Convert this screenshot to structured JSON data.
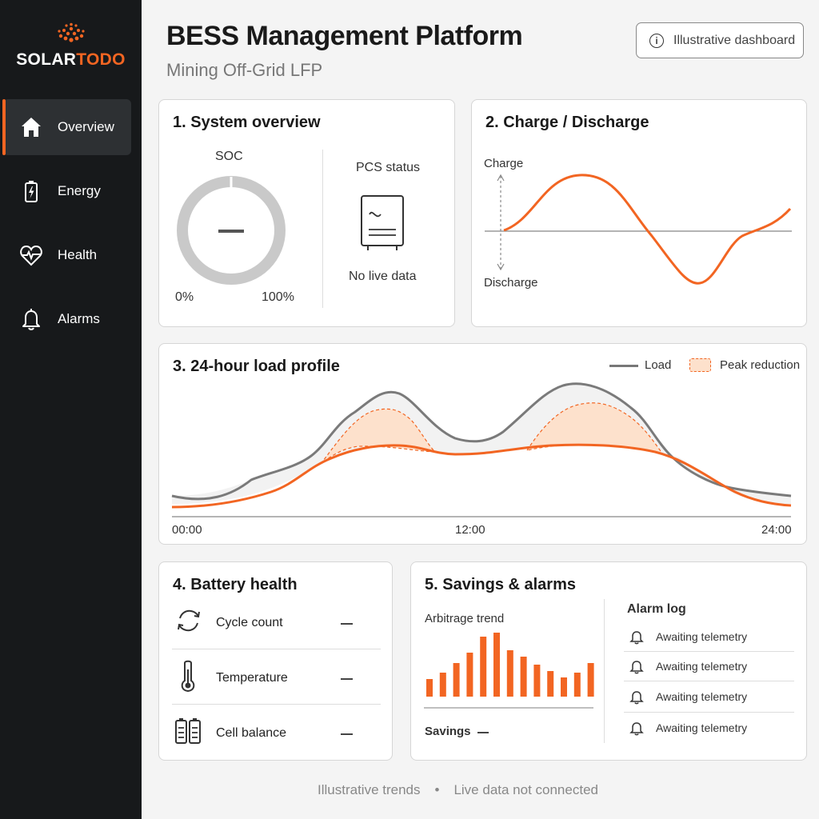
{
  "brand": {
    "part1": "SOLAR",
    "part2": "TODO",
    "accent": "#f26522"
  },
  "nav": [
    {
      "label": "Overview",
      "icon": "home-icon",
      "active": true
    },
    {
      "label": "Energy",
      "icon": "battery-icon"
    },
    {
      "label": "Health",
      "icon": "heart-icon"
    },
    {
      "label": "Alarms",
      "icon": "bell-icon"
    }
  ],
  "header": {
    "title": "BESS Management Platform",
    "subtitle": "Mining Off-Grid LFP",
    "badge": "Illustrative dashboard"
  },
  "overview": {
    "title": "1.  System overview",
    "soc_label": "SOC",
    "soc_value": "—",
    "min": "0%",
    "max": "100%",
    "pcs_label": "PCS status",
    "pcs_status": "No live data"
  },
  "charge": {
    "title": "2.  Charge / Discharge",
    "up": "Charge",
    "down": "Discharge"
  },
  "load": {
    "title": "3.  24-hour load profile",
    "legend_load": "Load",
    "legend_peak": "Peak reduction",
    "x_start": "00:00",
    "x_mid": "12:00",
    "x_end": "24:00"
  },
  "health": {
    "title": "4.  Battery health",
    "rows": [
      {
        "label": "Cycle count",
        "value": "—",
        "icon": "cycle-icon"
      },
      {
        "label": "Temperature",
        "value": "—",
        "icon": "thermometer-icon"
      },
      {
        "label": "Cell balance",
        "value": "—",
        "icon": "cells-icon"
      }
    ]
  },
  "savings": {
    "title": "5.  Savings & alarms",
    "trend_label": "Arbitrage trend",
    "savings_label": "Savings",
    "savings_value": "—",
    "bars": [
      22,
      30,
      42,
      55,
      75,
      80,
      58,
      50,
      40,
      32,
      24,
      30,
      42
    ],
    "alarm_title": "Alarm log",
    "alarms": [
      "Awaiting telemetry",
      "Awaiting telemetry",
      "Awaiting telemetry",
      "Awaiting telemetry"
    ]
  },
  "footer": {
    "left": "Illustrative trends",
    "sep": "•",
    "right": "Live data not connected"
  }
}
